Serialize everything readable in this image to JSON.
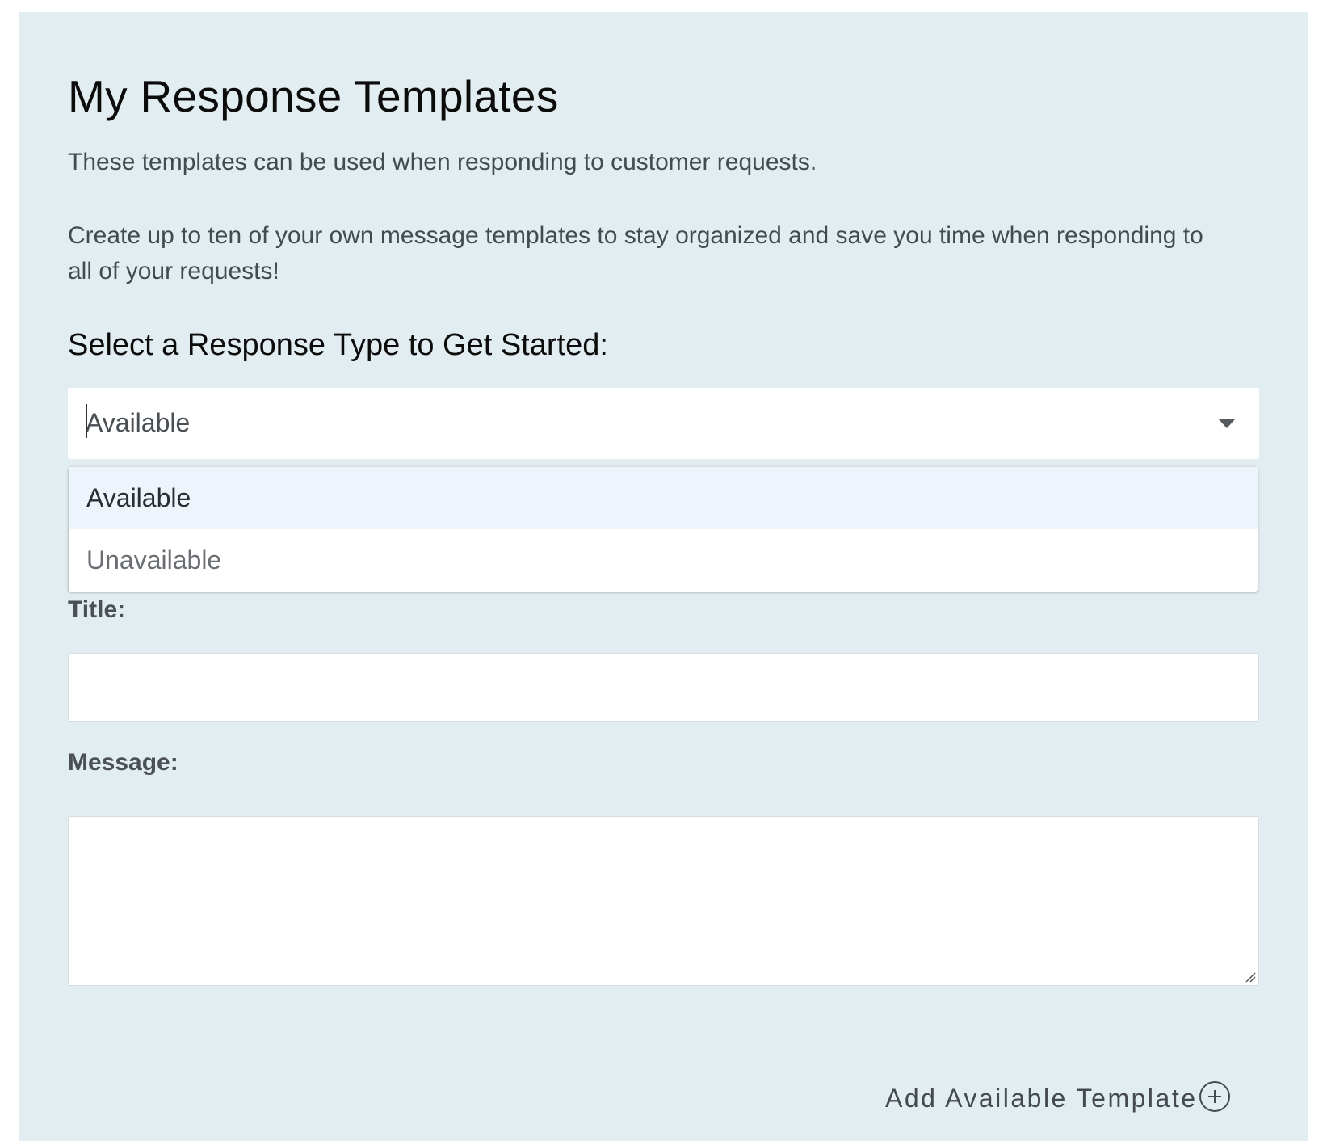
{
  "header": {
    "title": "My Response Templates",
    "intro_1": "These templates can be used when responding to customer requests.",
    "intro_2": "Create up to ten of your own message templates to stay organized and save you time when responding to all of your requests!"
  },
  "response_type": {
    "heading": "Select a Response Type to Get Started:",
    "selected_value": "Available",
    "options": [
      {
        "label": "Available",
        "highlighted": true
      },
      {
        "label": "Unavailable",
        "highlighted": false
      }
    ]
  },
  "form": {
    "title_label": "Title:",
    "title_value": "",
    "message_label": "Message:",
    "message_value": ""
  },
  "actions": {
    "add_label": "Add Available Template",
    "add_icon": "plus-circle-icon"
  },
  "colors": {
    "panel_background": "#e2edf1",
    "highlight_option": "#edf4fc"
  }
}
